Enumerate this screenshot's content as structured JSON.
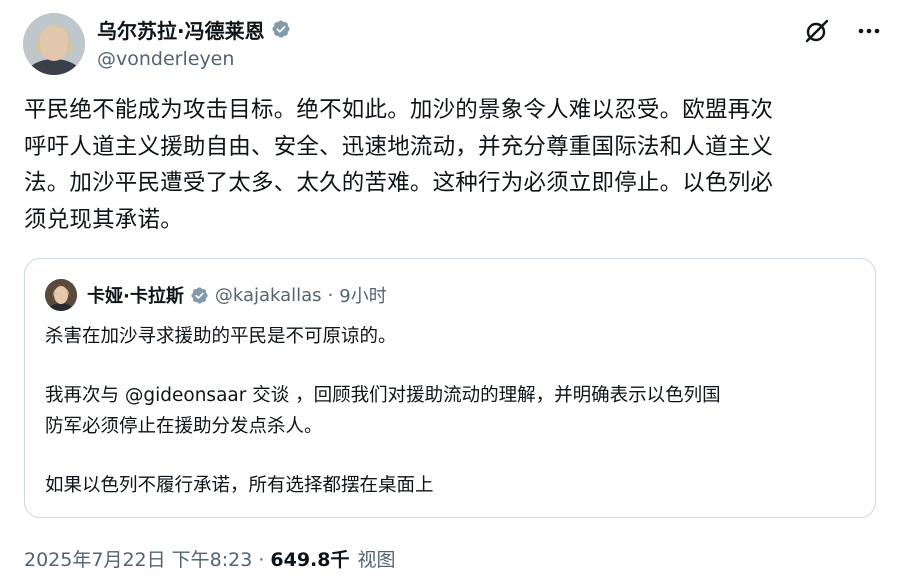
{
  "author": {
    "display_name": "乌尔苏拉·冯德莱恩",
    "handle": "@vonderleyen"
  },
  "icons": {
    "verified": "verified-badge-icon",
    "grok": "grok-icon",
    "more": "more-icon"
  },
  "colors": {
    "verified_badge": "#829aab",
    "secondary_text": "#536471",
    "border": "#cfd9de"
  },
  "post": {
    "text_lines": [
      "平民绝不能成为攻击目标。绝不如此。加沙的景象令人难以忍受。欧盟再次",
      "呼吁人道主义援助自由、安全、迅速地流动，并充分尊重国际法和人道主义",
      "法。加沙平民遭受了太多、太久的苦难。这种行为必须立即停止。以色列必",
      "须兑现其承诺。"
    ]
  },
  "quote": {
    "display_name": "卡娅·卡拉斯",
    "handle": "@kajakallas",
    "dot": "·",
    "time": "9小时",
    "paragraph1": "杀害在加沙寻求援助的平民是不可原谅的。",
    "paragraph2_line1": "我再次与 @gideonsaar 交谈 ，回顾我们对援助流动的理解，并明确表示以色列国",
    "paragraph2_line2": "防军必须停止在援助分发点杀人。",
    "paragraph3": "如果以色列不履行承诺，所有选择都摆在桌面上"
  },
  "meta": {
    "timestamp": "2025年7月22日 下午8:23",
    "sep": "·",
    "views_count": "649.8千",
    "views_label": "视图"
  }
}
